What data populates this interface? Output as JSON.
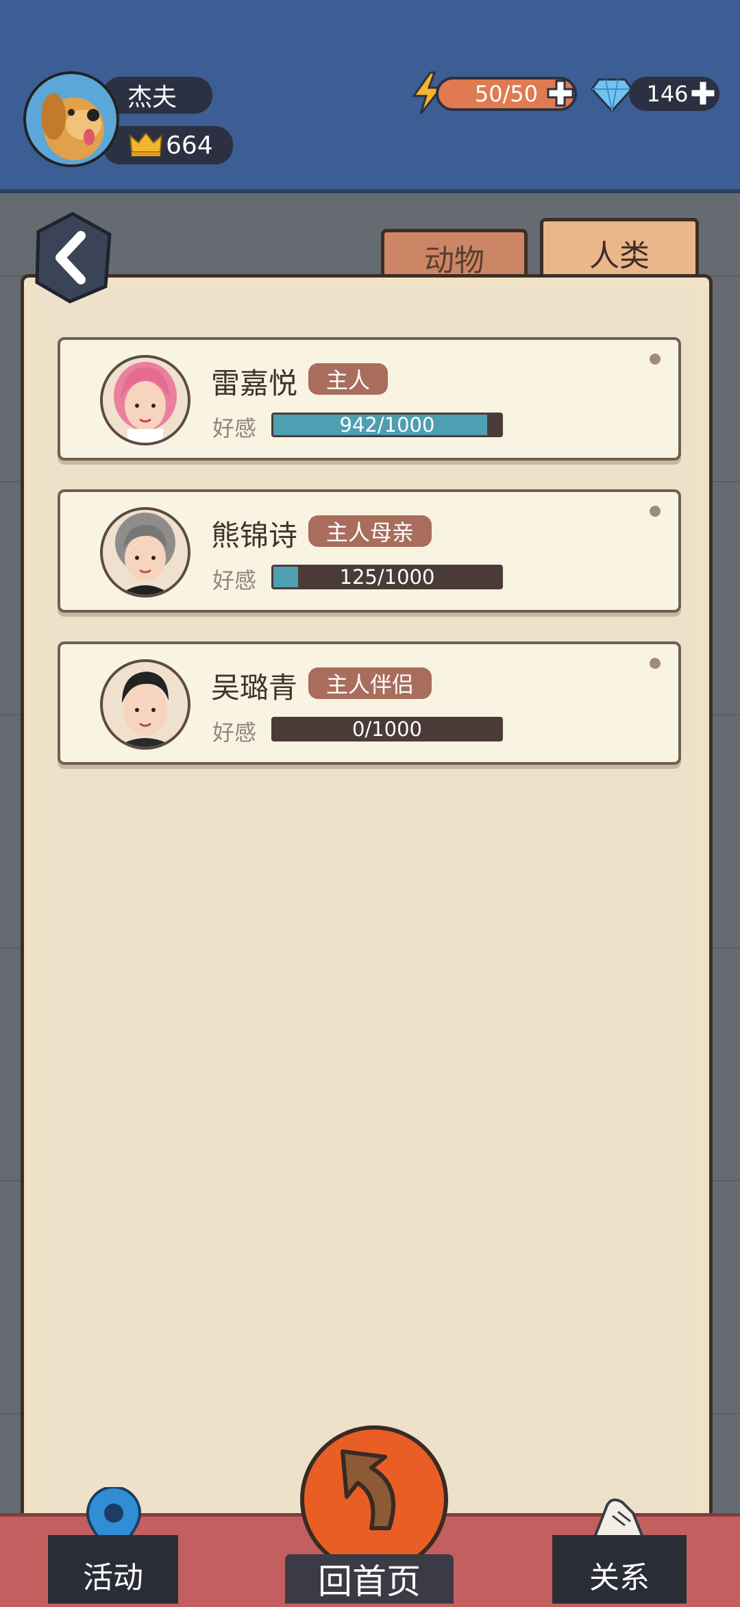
{
  "header": {
    "player_name": "杰夫",
    "crowns": "664",
    "energy": "50/50",
    "gems": "146"
  },
  "tabs": [
    {
      "label": "动物",
      "selected": false
    },
    {
      "label": "人类",
      "selected": true
    }
  ],
  "relations": [
    {
      "name": "雷嘉悦",
      "role": "主人",
      "affection_label": "好感",
      "affection_text": "942/1000",
      "affection_fraction": 0.942
    },
    {
      "name": "熊锦诗",
      "role": "主人母亲",
      "affection_label": "好感",
      "affection_text": "125/1000",
      "affection_fraction": 0.125
    },
    {
      "name": "吴璐青",
      "role": "主人伴侣",
      "affection_label": "好感",
      "affection_text": "0/1000",
      "affection_fraction": 0.0
    }
  ],
  "bottom_nav": {
    "activity": "活动",
    "home": "回首页",
    "relations": "关系"
  },
  "colors": {
    "header_bg": "#3d5e94",
    "energy": "#e07a51",
    "affection_fill": "#4d9fb1",
    "role_tag": "#a86d5c",
    "home_button": "#e85e25"
  }
}
